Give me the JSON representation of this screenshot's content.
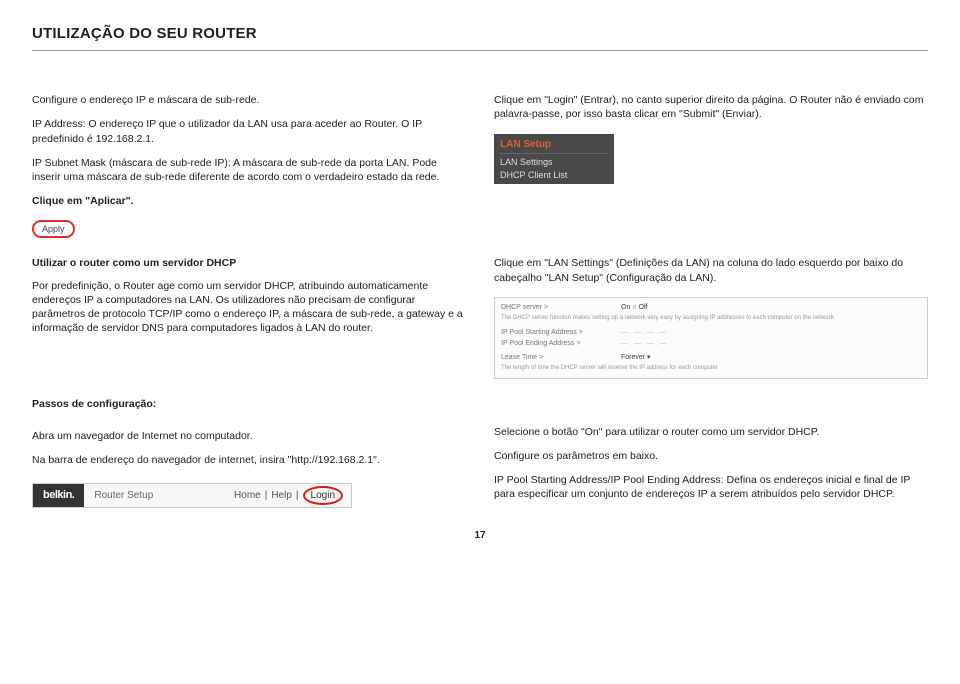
{
  "title": "UTILIZAÇÃO DO SEU ROUTER",
  "left1": {
    "p1": "Configure o endereço IP e máscara de sub-rede.",
    "p2": "IP Address: O endereço IP que o utilizador da LAN usa para aceder ao Router. O IP predefinido é 192.168.2.1.",
    "p3": "IP Subnet Mask (máscara de sub-rede IP): A máscara de sub-rede da porta LAN. Pode inserir uma máscara de sub-rede diferente de acordo com o verdadeiro estado da rede.",
    "p4": "Clique em \"Aplicar\"."
  },
  "right1": {
    "p1": "Clique em \"Login\" (Entrar), no canto superior direito da página. O Router não é enviado com palavra-passe, por isso basta clicar em \"Submit\" (Enviar).",
    "lan_setup": "LAN Setup",
    "lan_settings": "LAN Settings",
    "dhcp_list": "DHCP Client List"
  },
  "left2": {
    "head": "Utilizar o router como um servidor DHCP",
    "p1": "Por predefinição, o Router age como um servidor DHCP, atribuindo automaticamente endereços IP a computadores na LAN. Os utilizadores não precisam de configurar parâmetros de protocolo TCP/IP como o endereço IP, a máscara de sub-rede, a gateway e a informação de servidor DNS para computadores ligados à LAN do router."
  },
  "right2": {
    "p1": "Clique em \"LAN Settings\" (Definições da LAN) na coluna do lado esquerdo por baixo do cabeçalho \"LAN Setup\" (Configuração da LAN).",
    "mock": {
      "server": "DHCP server >",
      "server_opt": "On  ○  Off",
      "desc": "The DHCP server function makes setting up a network very easy by assigning IP addresses to each computer on the network.",
      "start": "IP Pool Starting Address >",
      "end": "IP Pool Ending Address >",
      "lease": "Lease Time >",
      "lease_val": "Forever ▾",
      "foot": "The length of time the DHCP server will reserve the IP address for each computer"
    }
  },
  "left3": {
    "head": "Passos de configuração:",
    "p1": "Abra um navegador de Internet no computador.",
    "p2": "Na barra de endereço do navegador de internet, insira \"http://192.168.2.1\".",
    "belkin": "belkin.",
    "setup": "Router Setup",
    "home": "Home",
    "help": "Help",
    "login": "Login"
  },
  "right3": {
    "p1": "Selecione o botão \"On\" para utilizar o router como um servidor DHCP.",
    "p2": "Configure os parâmetros em baixo.",
    "p3": "IP Pool Starting Address/IP Pool Ending Address: Defina os endereços inicial e final de IP para especificar um conjunto de endereços IP a serem atribuídos pelo servidor DHCP."
  },
  "page_number": "17"
}
